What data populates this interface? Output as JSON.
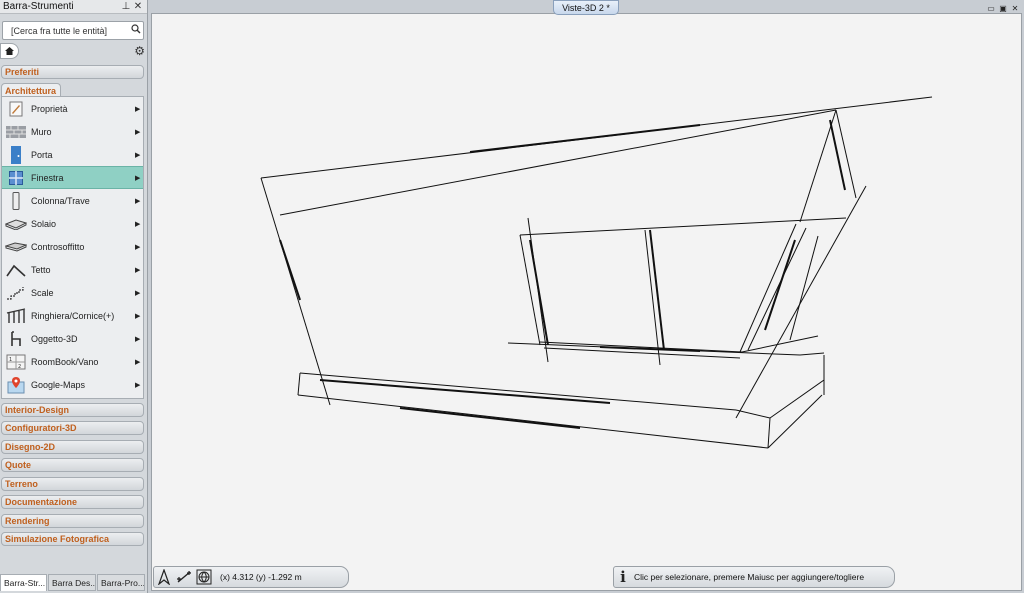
{
  "panel": {
    "title": "Barra-Strumenti",
    "pin_glyph": "⊥",
    "close_glyph": "✕",
    "search": {
      "placeholder": "[Cerca fra tutte le entità]",
      "value": "[Cerca fra tutte le entità]"
    },
    "categories_top": [
      "Preferiti"
    ],
    "active_category": "Architettura",
    "items": [
      {
        "label": "Proprietà",
        "icon": "properties-icon"
      },
      {
        "label": "Muro",
        "icon": "wall-icon"
      },
      {
        "label": "Porta",
        "icon": "door-icon"
      },
      {
        "label": "Finestra",
        "icon": "window-icon",
        "selected": true
      },
      {
        "label": "Colonna/Trave",
        "icon": "column-icon"
      },
      {
        "label": "Solaio",
        "icon": "slab-icon"
      },
      {
        "label": "Controsoffitto",
        "icon": "ceiling-icon"
      },
      {
        "label": "Tetto",
        "icon": "roof-icon"
      },
      {
        "label": "Scale",
        "icon": "stairs-icon"
      },
      {
        "label": "Ringhiera/Cornice(+)",
        "icon": "railing-icon"
      },
      {
        "label": "Oggetto-3D",
        "icon": "chair-icon"
      },
      {
        "label": "RoomBook/Vano",
        "icon": "room-icon"
      },
      {
        "label": "Google-Maps",
        "icon": "map-icon"
      }
    ],
    "categories_bottom": [
      "Interior-Design",
      "Configuratori-3D",
      "Disegno-2D",
      "Quote",
      "Terreno",
      "Documentazione",
      "Rendering",
      "Simulazione Fotografica"
    ],
    "bottom_tabs": [
      "Barra-Str...",
      "Barra Des...",
      "Barra-Pro..."
    ]
  },
  "view": {
    "tab_label": "Viste-3D 2 *",
    "controls": [
      "▭",
      "▣",
      "✕"
    ]
  },
  "status": {
    "coords": "(x) 4.312   (y) -1.292 m",
    "message": "Clic per selezionare, premere Maiusc per aggiungere/togliere",
    "info_glyph": "i"
  },
  "colors": {
    "accent": "#c0601e",
    "selection": "#8fd0c4",
    "view_bg": "#f3f3f3"
  }
}
